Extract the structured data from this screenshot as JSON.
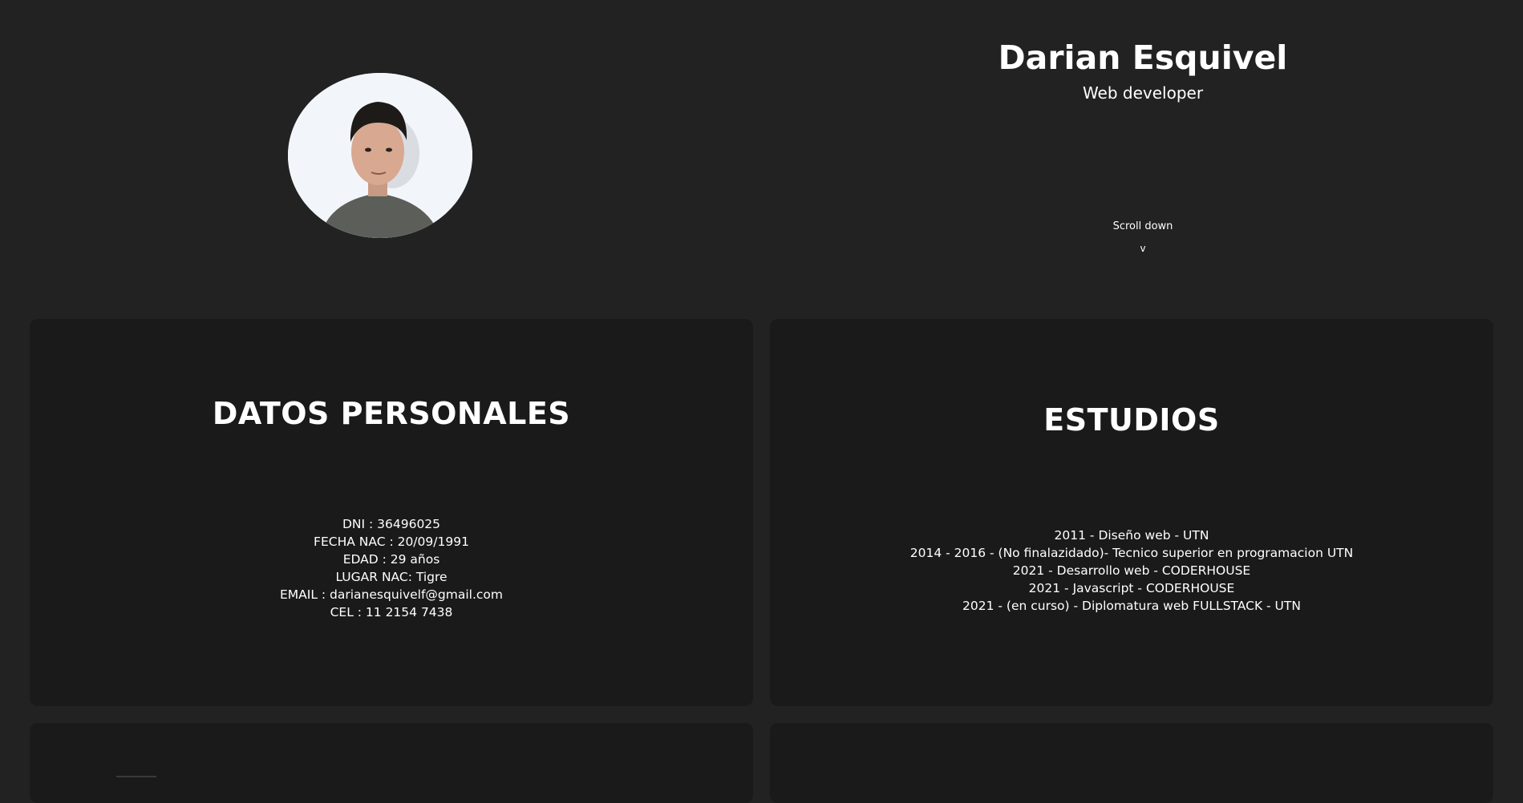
{
  "hero": {
    "name": "Darian Esquivel",
    "role": "Web developer",
    "scroll_label": "Scroll down",
    "scroll_arrow": "v"
  },
  "personal": {
    "title": "DATOS PERSONALES",
    "lines": [
      "DNI : 36496025",
      "FECHA NAC : 20/09/1991",
      "EDAD : 29 años",
      "LUGAR NAC: Tigre",
      "EMAIL : darianesquivelf@gmail.com",
      "CEL : 11 2154 7438"
    ]
  },
  "studies": {
    "title": "ESTUDIOS",
    "lines": [
      "2011 - Diseño web - UTN",
      "2014 - 2016 - (No finalazidado)- Tecnico superior en programacion UTN",
      "2021 - Desarrollo web - CODERHOUSE",
      "2021 - Javascript - CODERHOUSE",
      "2021 - (en curso) - Diplomatura web FULLSTACK - UTN"
    ]
  },
  "colors": {
    "page_background": "#222222",
    "card_background": "#1a1a1b",
    "text": "#ffffff"
  }
}
